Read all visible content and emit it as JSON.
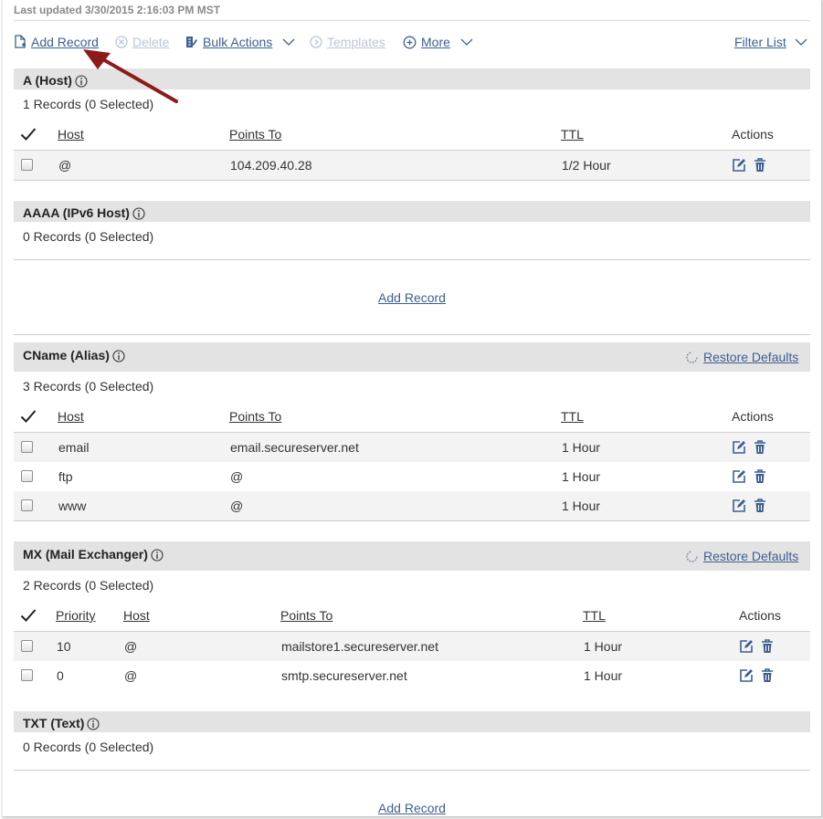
{
  "last_updated": "Last updated 3/30/2015 2:16:03 PM MST",
  "toolbar": {
    "add_record": "Add Record",
    "delete": "Delete",
    "bulk_actions": "Bulk Actions",
    "templates": "Templates",
    "more": "More",
    "filter_list": "Filter List"
  },
  "sections": {
    "a": {
      "title": "A (Host)",
      "count": "1 Records (0 Selected)",
      "columns": [
        "Host",
        "Points To",
        "TTL",
        "Actions"
      ],
      "rows": [
        {
          "host": "@",
          "points_to": "104.209.40.28",
          "ttl": "1/2 Hour"
        }
      ]
    },
    "aaaa": {
      "title": "AAAA (IPv6 Host)",
      "count": "0 Records (0 Selected)",
      "add_record": "Add Record"
    },
    "cname": {
      "title": "CName (Alias)",
      "restore": "Restore Defaults",
      "count": "3 Records (0 Selected)",
      "columns": [
        "Host",
        "Points To",
        "TTL",
        "Actions"
      ],
      "rows": [
        {
          "host": "email",
          "points_to": "email.secureserver.net",
          "ttl": "1 Hour"
        },
        {
          "host": "ftp",
          "points_to": "@",
          "ttl": "1 Hour"
        },
        {
          "host": "www",
          "points_to": "@",
          "ttl": "1 Hour"
        }
      ]
    },
    "mx": {
      "title": "MX (Mail Exchanger)",
      "restore": "Restore Defaults",
      "count": "2 Records (0 Selected)",
      "columns": [
        "Priority",
        "Host",
        "Points To",
        "TTL",
        "Actions"
      ],
      "rows": [
        {
          "priority": "10",
          "host": "@",
          "points_to": "mailstore1.secureserver.net",
          "ttl": "1 Hour"
        },
        {
          "priority": "0",
          "host": "@",
          "points_to": "smtp.secureserver.net",
          "ttl": "1 Hour"
        }
      ]
    },
    "txt": {
      "title": "TXT (Text)",
      "count": "0 Records (0 Selected)",
      "add_record": "Add Record"
    }
  },
  "colors": {
    "link": "#3d5f91",
    "disabled_link": "#b9c6da",
    "section_header_bg": "#e3e3e3",
    "row_alt_bg": "#f3f3f3",
    "annotation_arrow": "#9b1c1c"
  },
  "icons": [
    "add-document-icon",
    "delete-circle-icon",
    "bulk-edit-icon",
    "chevron-down-icon",
    "templates-circle-icon",
    "plus-circle-icon",
    "info-icon",
    "checkmark-icon",
    "edit-icon",
    "trash-icon",
    "restore-icon",
    "annotation-arrow"
  ]
}
